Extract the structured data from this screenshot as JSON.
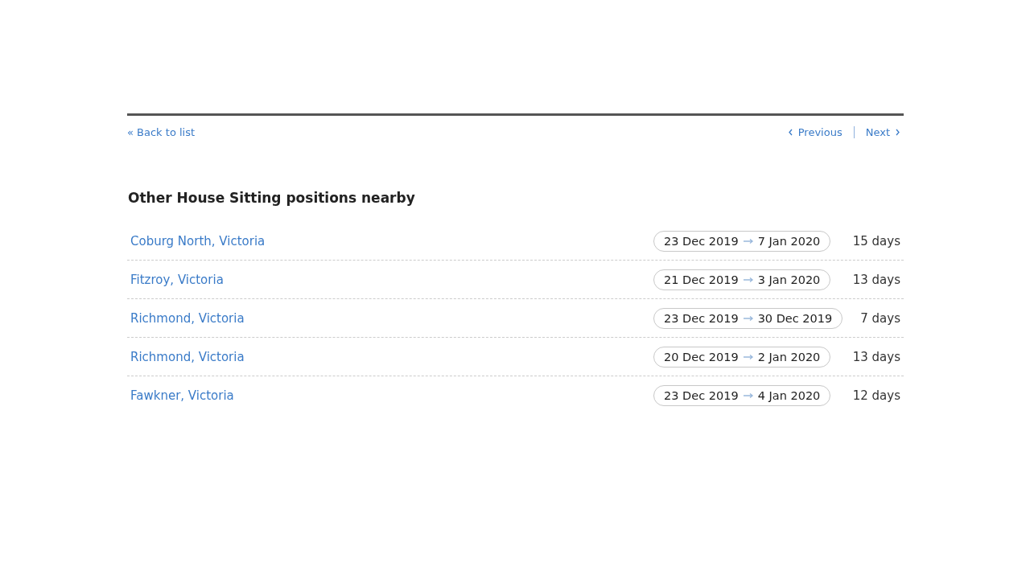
{
  "nav": {
    "back": "« Back to list",
    "previous": "Previous",
    "next": "Next"
  },
  "section": {
    "title": "Other House Sitting positions nearby"
  },
  "positions": [
    {
      "location": "Coburg North, Victoria",
      "start": "23 Dec 2019",
      "end": "7 Jan 2020",
      "duration": "15 days"
    },
    {
      "location": "Fitzroy, Victoria",
      "start": "21 Dec 2019",
      "end": "3 Jan 2020",
      "duration": "13 days"
    },
    {
      "location": "Richmond, Victoria",
      "start": "23 Dec 2019",
      "end": "30 Dec 2019",
      "duration": "7 days"
    },
    {
      "location": "Richmond, Victoria",
      "start": "20 Dec 2019",
      "end": "2 Jan 2020",
      "duration": "13 days"
    },
    {
      "location": "Fawkner, Victoria",
      "start": "23 Dec 2019",
      "end": "4 Jan 2020",
      "duration": "12 days"
    }
  ]
}
